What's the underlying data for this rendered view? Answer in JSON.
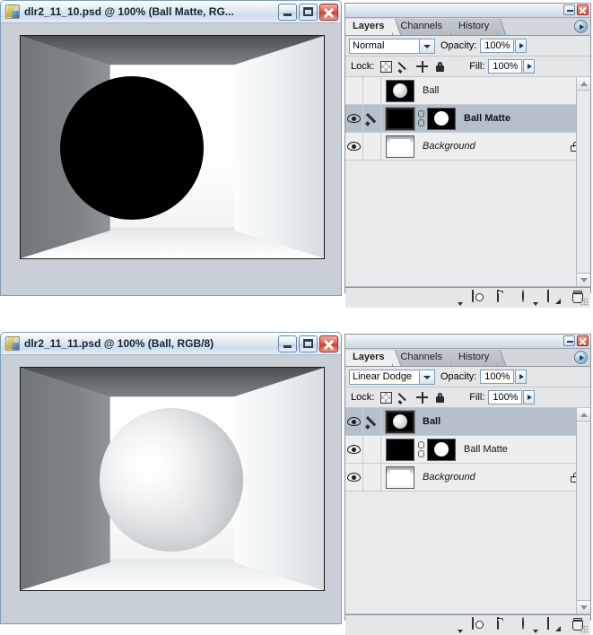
{
  "windows": [
    {
      "id": "win-top",
      "title": "dlr2_11_10.psd @ 100% (Ball Matte, RG...",
      "icon": "photoshop-document-icon",
      "buttons": {
        "minimize": "Minimize",
        "maximize": "Maximize",
        "close": "Close"
      },
      "canvas": {
        "description": "Black matte circle in 3D box interior",
        "ball_style": "matte"
      },
      "palette": {
        "tabs": [
          {
            "label": "Layers",
            "active": true
          },
          {
            "label": "Channels",
            "active": false
          },
          {
            "label": "History",
            "active": false
          }
        ],
        "menu_icon": "palette-menu-icon",
        "blend_mode": "Normal",
        "opacity_label": "Opacity:",
        "opacity_value": "100%",
        "lock_label": "Lock:",
        "fill_label": "Fill:",
        "fill_value": "100%",
        "lock_icons": [
          "lock-transparent-pixels-icon",
          "lock-image-pixels-icon",
          "lock-position-icon",
          "lock-all-icon"
        ],
        "layers": [
          {
            "name": "Ball",
            "visible": false,
            "active_brush": false,
            "selected": false,
            "bold": false,
            "italic": false,
            "locked": false,
            "thumb": "thumb-ballblack",
            "has_mask": false,
            "thumb_active": false
          },
          {
            "name": "Ball Matte",
            "visible": true,
            "active_brush": true,
            "selected": true,
            "bold": true,
            "italic": false,
            "locked": false,
            "thumb": "thumb-black",
            "has_mask": true,
            "mask_thumb": "thumb-mask",
            "link_icon": "layer-mask-link-icon",
            "thumb_active": true
          },
          {
            "name": "Background",
            "visible": true,
            "active_brush": false,
            "selected": false,
            "bold": false,
            "italic": true,
            "locked": true,
            "lock_icon": "layer-locked-icon",
            "thumb": "thumb-bg",
            "has_mask": false,
            "thumb_active": false
          }
        ],
        "bottom_icons": [
          "layer-style-fx-icon",
          "add-layer-mask-icon",
          "new-group-folder-icon",
          "new-adjustment-layer-icon",
          "new-layer-icon",
          "delete-layer-trash-icon"
        ],
        "scrollbar": {
          "up": "scroll-up-arrow-icon",
          "down": "scroll-down-arrow-icon"
        }
      }
    },
    {
      "id": "win-bottom",
      "title": "dlr2_11_11.psd @ 100% (Ball, RGB/8)",
      "icon": "photoshop-document-icon",
      "buttons": {
        "minimize": "Minimize",
        "maximize": "Maximize",
        "close": "Close"
      },
      "canvas": {
        "description": "Lit white sphere in 3D box interior",
        "ball_style": "lit"
      },
      "palette": {
        "tabs": [
          {
            "label": "Layers",
            "active": true
          },
          {
            "label": "Channels",
            "active": false
          },
          {
            "label": "History",
            "active": false
          }
        ],
        "menu_icon": "palette-menu-icon",
        "blend_mode": "Linear Dodge",
        "opacity_label": "Opacity:",
        "opacity_value": "100%",
        "lock_label": "Lock:",
        "fill_label": "Fill:",
        "fill_value": "100%",
        "lock_icons": [
          "lock-transparent-pixels-icon",
          "lock-image-pixels-icon",
          "lock-position-icon",
          "lock-all-icon"
        ],
        "layers": [
          {
            "name": "Ball",
            "visible": true,
            "active_brush": true,
            "selected": true,
            "bold": true,
            "italic": false,
            "locked": false,
            "thumb": "thumb-ballblack",
            "has_mask": false,
            "thumb_active": true
          },
          {
            "name": "Ball Matte",
            "visible": true,
            "active_brush": false,
            "selected": false,
            "bold": false,
            "italic": false,
            "locked": false,
            "thumb": "thumb-black",
            "has_mask": true,
            "mask_thumb": "thumb-mask",
            "link_icon": "layer-mask-link-icon",
            "thumb_active": false
          },
          {
            "name": "Background",
            "visible": true,
            "active_brush": false,
            "selected": false,
            "bold": false,
            "italic": true,
            "locked": true,
            "lock_icon": "layer-locked-icon",
            "thumb": "thumb-bg",
            "has_mask": false,
            "thumb_active": false
          }
        ],
        "bottom_icons": [
          "layer-style-fx-icon",
          "add-layer-mask-icon",
          "new-group-folder-icon",
          "new-adjustment-layer-icon",
          "new-layer-icon",
          "delete-layer-trash-icon"
        ],
        "scrollbar": {
          "up": "scroll-up-arrow-icon",
          "down": "scroll-down-arrow-icon"
        }
      }
    }
  ],
  "colors": {
    "titlebar_gradient_top": "#fdfefe",
    "titlebar_gradient_bottom": "#cfdcea",
    "window_body": "#c8cfd6",
    "palette_body": "#e4e6e8",
    "selected_layer": "#b5c0cc",
    "close_button": "#cf4132",
    "page_background": "#ffffff"
  }
}
